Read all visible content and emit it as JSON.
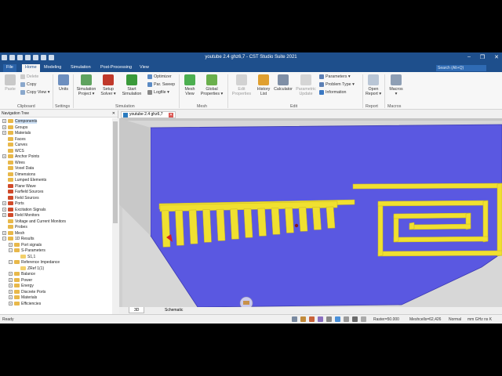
{
  "window": {
    "title": "youtube 2.4 ghz6,7 - CST Studio Suite 2021",
    "controls": [
      "–",
      "❐",
      "✕"
    ]
  },
  "menu": {
    "tabs": [
      "File",
      "Home",
      "Modeling",
      "Simulation",
      "Post-Processing",
      "View"
    ],
    "active": "Home",
    "search_placeholder": "Search (Alt+Q)"
  },
  "ribbon": {
    "clipboard": {
      "paste": "Paste",
      "delete": "Delete",
      "copy": "Copy",
      "copy_view": "Copy View",
      "group": "Clipboard"
    },
    "settings": {
      "units": "Units",
      "group": "Settings"
    },
    "simulation": {
      "project_1": "Simulation",
      "project_2": "Project",
      "setup_1": "Setup",
      "setup_2": "Solver",
      "start_1": "Start",
      "start_2": "Simulation",
      "optimizer": "Optimizer",
      "par_sweep": "Par. Sweep",
      "logfile": "Logfile",
      "group": "Simulation"
    },
    "mesh": {
      "mesh_1": "Mesh",
      "mesh_2": "View",
      "global_1": "Global",
      "global_2": "Properties",
      "group": "Mesh"
    },
    "edit": {
      "edit_1": "Edit",
      "edit_2": "Properties",
      "history_1": "History",
      "history_2": "List",
      "calculator": "Calculator",
      "param_1": "Parametric",
      "param_2": "Update",
      "parameters": "Parameters",
      "problem_type": "Problem Type",
      "information": "Information",
      "group": "Edit"
    },
    "report": {
      "open_1": "Open",
      "open_2": "Report",
      "group": "Report"
    },
    "macros": {
      "macros": "Macros"
    }
  },
  "nav": {
    "title": "Navigation Tree",
    "items": [
      {
        "label": "Components",
        "icon": "folder-icon",
        "expander": "+",
        "selected": true
      },
      {
        "label": "Groups",
        "icon": "folder-icon",
        "expander": "+"
      },
      {
        "label": "Materials",
        "icon": "folder-icon",
        "expander": "+"
      },
      {
        "label": "Faces",
        "icon": "folder-icon",
        "expander": ""
      },
      {
        "label": "Curves",
        "icon": "folder-icon",
        "expander": ""
      },
      {
        "label": "WCS",
        "icon": "folder-icon",
        "expander": ""
      },
      {
        "label": "Anchor Points",
        "icon": "folder-icon",
        "expander": "+"
      },
      {
        "label": "Wires",
        "icon": "folder-icon",
        "expander": ""
      },
      {
        "label": "Voxel Data",
        "icon": "folder-icon",
        "expander": ""
      },
      {
        "label": "Dimensions",
        "icon": "folder-icon",
        "expander": ""
      },
      {
        "label": "Lumped Elements",
        "icon": "folder-icon",
        "expander": ""
      },
      {
        "label": "Plane Wave",
        "icon": "red-folder-icon",
        "expander": ""
      },
      {
        "label": "Farfield Sources",
        "icon": "red-folder-icon",
        "expander": ""
      },
      {
        "label": "Field Sources",
        "icon": "red-folder-icon",
        "expander": ""
      },
      {
        "label": "Ports",
        "icon": "red-folder-icon",
        "expander": "+"
      },
      {
        "label": "Excitation Signals",
        "icon": "red-folder-icon",
        "expander": "+"
      },
      {
        "label": "Field Monitors",
        "icon": "red-folder-icon",
        "expander": "+"
      },
      {
        "label": "Voltage and Current Monitors",
        "icon": "folder-icon",
        "expander": ""
      },
      {
        "label": "Probes",
        "icon": "folder-icon",
        "expander": ""
      },
      {
        "label": "Mesh",
        "icon": "folder-icon",
        "expander": "+"
      },
      {
        "label": "1D Results",
        "icon": "folder-icon",
        "expander": "−"
      },
      {
        "label": "Port signals",
        "icon": "folder-icon",
        "expander": "+",
        "indent": 1
      },
      {
        "label": "S-Parameters",
        "icon": "folder-icon",
        "expander": "−",
        "indent": 1
      },
      {
        "label": "S1,1",
        "icon": "plot-icon",
        "expander": "",
        "indent": 2
      },
      {
        "label": "Reference Impedance",
        "icon": "folder-icon",
        "expander": "−",
        "indent": 1
      },
      {
        "label": "ZRef 1(1)",
        "icon": "plot-icon",
        "expander": "",
        "indent": 2
      },
      {
        "label": "Balance",
        "icon": "folder-icon",
        "expander": "+",
        "indent": 1
      },
      {
        "label": "Power",
        "icon": "folder-icon",
        "expander": "+",
        "indent": 1
      },
      {
        "label": "Energy",
        "icon": "folder-icon",
        "expander": "+",
        "indent": 1
      },
      {
        "label": "Discrete Ports",
        "icon": "folder-icon",
        "expander": "+",
        "indent": 1
      },
      {
        "label": "Materials",
        "icon": "folder-icon",
        "expander": "+",
        "indent": 1
      },
      {
        "label": "Efficiencies",
        "icon": "folder-icon",
        "expander": "+",
        "indent": 1
      }
    ]
  },
  "document": {
    "tab": "youtube 2.4 ghz6,7"
  },
  "view_tabs": [
    "3D",
    "Schematic"
  ],
  "status": {
    "ready": "Ready",
    "raster": "Raster=50.000",
    "meshcells": "Meshcells=62,426",
    "normal": "Normal",
    "units": "mm  GHz  ns  K"
  },
  "colors": {
    "substrate": "#5757e0",
    "copper": "#f0e030",
    "background": "#d8d8d8",
    "accent": "#1e4f8c"
  }
}
